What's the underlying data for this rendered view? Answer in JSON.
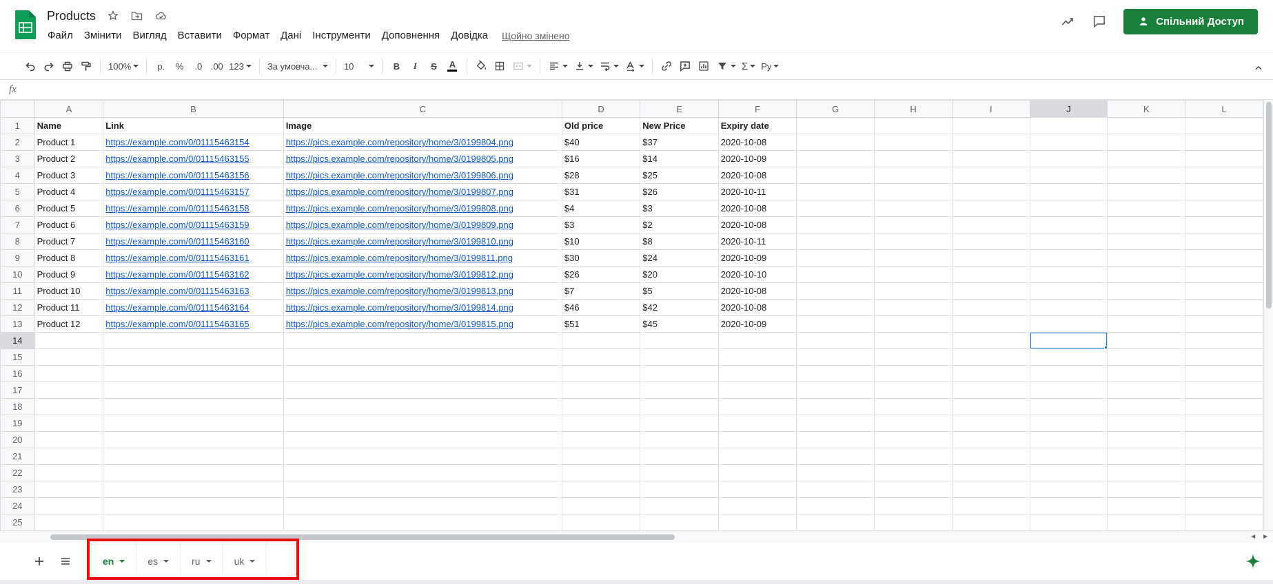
{
  "titlebar": {
    "doc_title": "Products",
    "menus": [
      "Файл",
      "Змінити",
      "Вигляд",
      "Вставити",
      "Формат",
      "Дані",
      "Інструменти",
      "Доповнення",
      "Довідка"
    ],
    "last_edited": "Щойно змінено",
    "share_button": "Спільний Доступ"
  },
  "toolbar": {
    "zoom": "100%",
    "currency_label": "р.",
    "percent_label": "%",
    "decimal_decrease": ".0",
    "decimal_increase": ".00",
    "more_formats": "123",
    "font_name": "За умовча...",
    "font_size": "10",
    "bold_label": "B",
    "italic_label": "I",
    "strikethrough_label": "S",
    "text_color_label": "A",
    "functions_label": "Σ",
    "input_tools_label": "Ру"
  },
  "formula_bar": {
    "fx_label": "fx"
  },
  "grid": {
    "columns": [
      "A",
      "B",
      "C",
      "D",
      "E",
      "F",
      "G",
      "H",
      "I",
      "J",
      "K",
      "L"
    ],
    "row_count": 25,
    "header_row": [
      "Name",
      "Link",
      "Image",
      "Old price",
      "New Price",
      "Expiry date"
    ],
    "selected_cell": {
      "column": "J",
      "row": 14
    },
    "rows": [
      {
        "name": "Product 1",
        "link": "https://example.com/0/01115463154",
        "image": "https://pics.example.com/repository/home/3/0199804.png",
        "old_price": "$40",
        "new_price": "$37",
        "expiry": "2020-10-08"
      },
      {
        "name": "Product 2",
        "link": "https://example.com/0/01115463155",
        "image": "https://pics.example.com/repository/home/3/0199805.png",
        "old_price": "$16",
        "new_price": "$14",
        "expiry": "2020-10-09"
      },
      {
        "name": "Product 3",
        "link": "https://example.com/0/01115463156",
        "image": "https://pics.example.com/repository/home/3/0199806.png",
        "old_price": "$28",
        "new_price": "$25",
        "expiry": "2020-10-08"
      },
      {
        "name": "Product 4",
        "link": "https://example.com/0/01115463157",
        "image": "https://pics.example.com/repository/home/3/0199807.png",
        "old_price": "$31",
        "new_price": "$26",
        "expiry": "2020-10-11"
      },
      {
        "name": "Product 5",
        "link": "https://example.com/0/01115463158",
        "image": "https://pics.example.com/repository/home/3/0199808.png",
        "old_price": "$4",
        "new_price": "$3",
        "expiry": "2020-10-08"
      },
      {
        "name": "Product 6",
        "link": "https://example.com/0/01115463159",
        "image": "https://pics.example.com/repository/home/3/0199809.png",
        "old_price": "$3",
        "new_price": "$2",
        "expiry": "2020-10-08"
      },
      {
        "name": "Product 7",
        "link": "https://example.com/0/01115463160",
        "image": "https://pics.example.com/repository/home/3/0199810.png",
        "old_price": "$10",
        "new_price": "$8",
        "expiry": "2020-10-11"
      },
      {
        "name": "Product 8",
        "link": "https://example.com/0/01115463161",
        "image": "https://pics.example.com/repository/home/3/0199811.png",
        "old_price": "$30",
        "new_price": "$24",
        "expiry": "2020-10-09"
      },
      {
        "name": "Product 9",
        "link": "https://example.com/0/01115463162",
        "image": "https://pics.example.com/repository/home/3/0199812.png",
        "old_price": "$26",
        "new_price": "$20",
        "expiry": "2020-10-10"
      },
      {
        "name": "Product 10",
        "link": "https://example.com/0/01115463163",
        "image": "https://pics.example.com/repository/home/3/0199813.png",
        "old_price": "$7",
        "new_price": "$5",
        "expiry": "2020-10-08"
      },
      {
        "name": "Product 11",
        "link": "https://example.com/0/01115463164",
        "image": "https://pics.example.com/repository/home/3/0199814.png",
        "old_price": "$46",
        "new_price": "$42",
        "expiry": "2020-10-08"
      },
      {
        "name": "Product 12",
        "link": "https://example.com/0/01115463165",
        "image": "https://pics.example.com/repository/home/3/0199815.png",
        "old_price": "$51",
        "new_price": "$45",
        "expiry": "2020-10-09"
      }
    ]
  },
  "sheetbar": {
    "tabs": [
      {
        "label": "en",
        "active": true
      },
      {
        "label": "es",
        "active": false
      },
      {
        "label": "ru",
        "active": false
      },
      {
        "label": "uk",
        "active": false
      }
    ]
  },
  "colors": {
    "logo_green": "#0f9d58",
    "accent_green": "#188038",
    "selection_blue": "#1a73e8",
    "link_blue": "#1155cc",
    "annotation_red": "#ea0c0c"
  }
}
